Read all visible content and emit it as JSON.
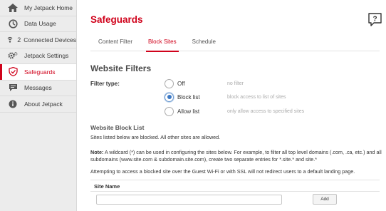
{
  "sidebar": {
    "items": [
      {
        "label": "My Jetpack Home",
        "icon": "home-icon"
      },
      {
        "label": "Data Usage",
        "icon": "data-usage-icon"
      },
      {
        "label": "Connected Devices",
        "icon": "devices-icon",
        "count": "2"
      },
      {
        "label": "Jetpack Settings",
        "icon": "gear-icon"
      },
      {
        "label": "Safeguards",
        "icon": "safeguards-icon",
        "active": true
      },
      {
        "label": "Messages",
        "icon": "messages-icon"
      },
      {
        "label": "About Jetpack",
        "icon": "info-icon"
      }
    ]
  },
  "header": {
    "title": "Safeguards",
    "help_icon_text": "?"
  },
  "tabs": [
    {
      "label": "Content Filter"
    },
    {
      "label": "Block Sites",
      "active": true
    },
    {
      "label": "Schedule"
    }
  ],
  "filters": {
    "section_title": "Website Filters",
    "filter_type_label": "Filter type:",
    "options": [
      {
        "label": "Off",
        "desc": "no filter",
        "checked": false
      },
      {
        "label": "Block list",
        "desc": "block access to list of sites",
        "checked": true
      },
      {
        "label": "Allow list",
        "desc": "only allow access to specified sites",
        "checked": false
      }
    ]
  },
  "block_list": {
    "title": "Website Block List",
    "intro": "Sites listed below are blocked. All other sites are allowed.",
    "note_label": "Note:",
    "note_text": " A wildcard (*) can be used in configuring the sites below. For example, to filter all top level domains (.com, .ca, etc.) and all subdomains (www.site.com & subdomain.site.com), create two separate entries for *.site.* and site.*",
    "guest_warning": "Attempting to access a blocked site over the Guest Wi-Fi or with SSL will not redirect users to a default landing page.",
    "column_header": "Site Name",
    "input_value": "",
    "add_label": "Add"
  },
  "colors": {
    "accent": "#d0021b",
    "radio_selected": "#3b78c4"
  }
}
